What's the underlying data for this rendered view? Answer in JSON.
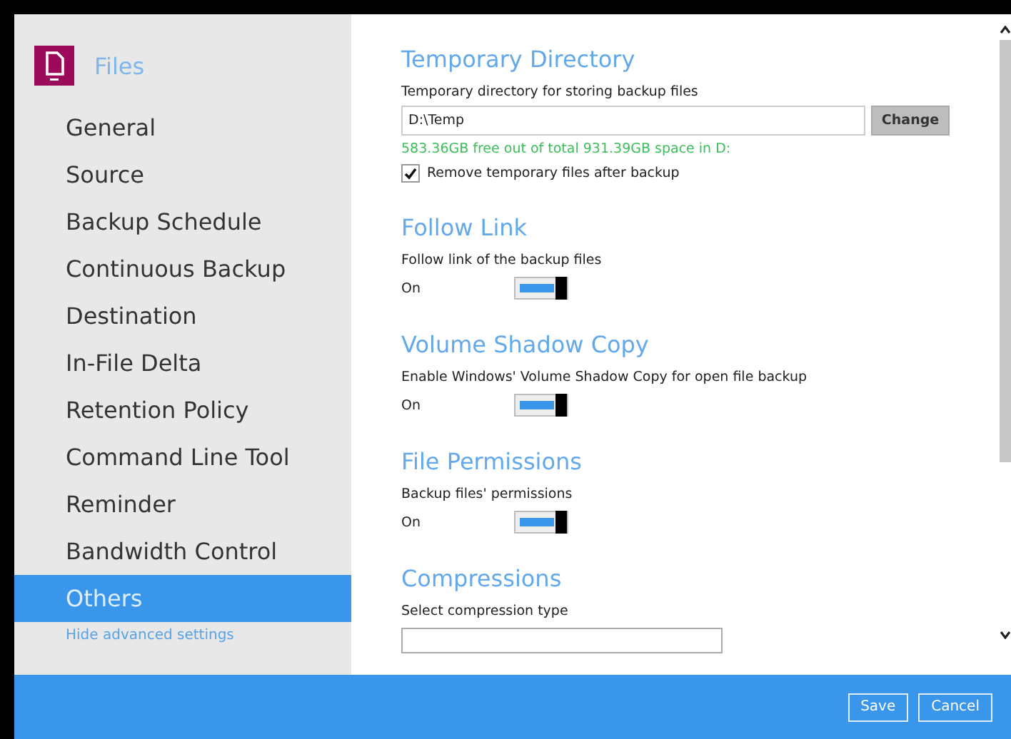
{
  "sidebar": {
    "title": "Files",
    "items": [
      {
        "label": "General",
        "selected": false
      },
      {
        "label": "Source",
        "selected": false
      },
      {
        "label": "Backup Schedule",
        "selected": false
      },
      {
        "label": "Continuous Backup",
        "selected": false
      },
      {
        "label": "Destination",
        "selected": false
      },
      {
        "label": "In-File Delta",
        "selected": false
      },
      {
        "label": "Retention Policy",
        "selected": false
      },
      {
        "label": "Command Line Tool",
        "selected": false
      },
      {
        "label": "Reminder",
        "selected": false
      },
      {
        "label": "Bandwidth Control",
        "selected": false
      },
      {
        "label": "Others",
        "selected": true
      }
    ],
    "link": "Hide advanced settings"
  },
  "sections": [
    {
      "kind": "directory",
      "heading": "Temporary Directory",
      "label": "Temporary directory for storing backup files",
      "value": "D:\\Temp",
      "button": "Change",
      "info": "583.36GB free out of total 931.39GB space in D:",
      "checkbox": {
        "label": "Remove temporary files after backup",
        "checked": true
      }
    },
    {
      "kind": "toggle",
      "heading": "Follow Link",
      "label": "Follow link of the backup files",
      "state": "On",
      "on": true
    },
    {
      "kind": "toggle",
      "heading": "Volume Shadow Copy",
      "label": "Enable Windows' Volume Shadow Copy for open file backup",
      "state": "On",
      "on": true
    },
    {
      "kind": "toggle",
      "heading": "File Permissions",
      "label": "Backup files' permissions",
      "state": "On",
      "on": true
    },
    {
      "kind": "select",
      "heading": "Compressions",
      "label": "Select compression type"
    }
  ],
  "footer": {
    "buttons": [
      "Save",
      "Cancel"
    ]
  }
}
